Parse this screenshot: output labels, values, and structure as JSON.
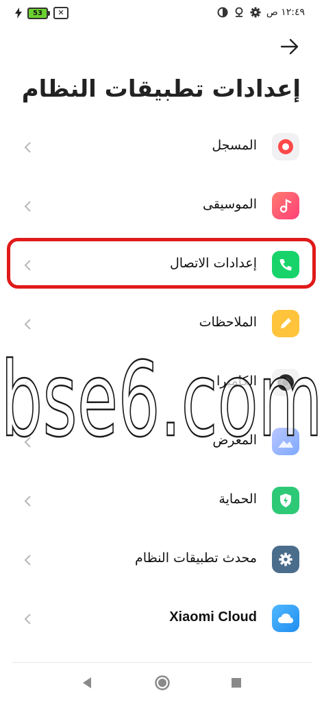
{
  "status_bar": {
    "battery_level": "53",
    "sim_indicator": "✕",
    "time": "١٢:٤٩ ص",
    "icons": [
      "charging-bolt-icon",
      "battery-icon",
      "no-sim-icon",
      "settings-gear-icon",
      "location-pin-icon",
      "data-saver-icon"
    ]
  },
  "header": {
    "back_icon": "arrow-right-icon",
    "title": "إعدادات تطبيقات النظام"
  },
  "items": [
    {
      "label": "المسجل",
      "icon": "recorder-icon",
      "color": "#f1f1f3"
    },
    {
      "label": "الموسيقى",
      "icon": "music-icon",
      "color": "#ff5a75"
    },
    {
      "label": "إعدادات الاتصال",
      "icon": "phone-icon",
      "color": "#17d36a",
      "highlighted": true
    },
    {
      "label": "الملاحظات",
      "icon": "notes-pencil-icon",
      "color": "#ffc43c"
    },
    {
      "label": "الكاميرا",
      "icon": "camera-icon",
      "color": "#2a2a2a"
    },
    {
      "label": "المعرض",
      "icon": "gallery-icon",
      "color": "#9fb7ff"
    },
    {
      "label": "الحماية",
      "icon": "security-shield-icon",
      "color": "#2ec977"
    },
    {
      "label": "محدث تطبيقات النظام",
      "icon": "updater-gear-icon",
      "color": "#4b6d8c"
    },
    {
      "label": "Xiaomi Cloud",
      "icon": "cloud-icon",
      "color": "#2c9cf5"
    }
  ],
  "watermark": "bse6.com",
  "nav": {
    "buttons": [
      "back-triangle-icon",
      "home-circle-icon",
      "recents-square-icon"
    ]
  }
}
